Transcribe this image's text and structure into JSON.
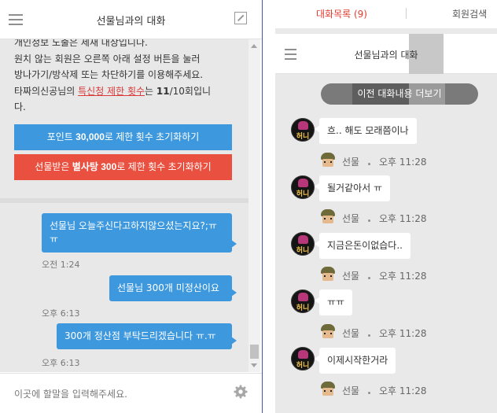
{
  "left": {
    "header": {
      "title": "선물님과의 대화"
    },
    "notice": {
      "line1": "개인정보 노출은 제재 대상입니다.",
      "line2": "원치 않는 회원은 오른쪽 아래 설정 버튼을 눌러",
      "line3": "방나가기/방삭제 또는 차단하기를 이용해주세요.",
      "line4_pre": "타짜의신공님의 ",
      "line4_link": "특신청 제한 횟수",
      "line4_mid": "는 ",
      "line4_count": "11",
      "line4_post": "/10회입니",
      "line5": "다."
    },
    "buttons": {
      "point": {
        "pre": "포인트 ",
        "amount": "30,000",
        "post": "로 제한 횟수 초기화하기"
      },
      "byeol": {
        "pre": "선물받은 ",
        "amount": "별사탕 300",
        "post": "로 제한 횟수 초기화하기"
      }
    },
    "messages": [
      {
        "text": "선물님 오늘주신다고하지않으셨는지요?;ㅠㅠ",
        "time": "오전 1:24"
      },
      {
        "text": "선물님 300개 미정산이요",
        "time": "오후 6:13"
      },
      {
        "text": "300개 정산점 부탁드리겠습니다 ㅠ.ㅠ",
        "time": "오후 6:13"
      }
    ],
    "composer": {
      "placeholder": "이곳에 할말을 입력해주세요."
    }
  },
  "right": {
    "nav": {
      "tab_list": "대화목록 (9)",
      "tab_search": "회원검색"
    },
    "header": {
      "title": "선물님과의 대화"
    },
    "more_button": "이전 대화내용 더보기",
    "avatar_text": "허니",
    "messages": [
      {
        "text": "흐.. 해도 모래쯤이나",
        "sender": "선물",
        "time": "오후 11:28"
      },
      {
        "text": "될거같아서 ㅠ",
        "sender": "선물",
        "time": "오후 11:28"
      },
      {
        "text": "지금은돈이없습다..",
        "sender": "선물",
        "time": "오후 11:28"
      },
      {
        "text": "ㅠㅠ",
        "sender": "선물",
        "time": "오후 11:28"
      },
      {
        "text": "이제시작한거라",
        "sender": "선물",
        "time": "오후 11:28"
      }
    ]
  },
  "colors": {
    "blue": "#3d98dd",
    "red": "#e9503f",
    "panel_gray": "#e8e8e8",
    "nav_red": "#e23c30"
  },
  "icons": [
    "hamburger-icon",
    "expand-icon",
    "gear-icon",
    "scroll-up-icon",
    "scroll-down-icon",
    "avatar",
    "mini-avatar"
  ]
}
